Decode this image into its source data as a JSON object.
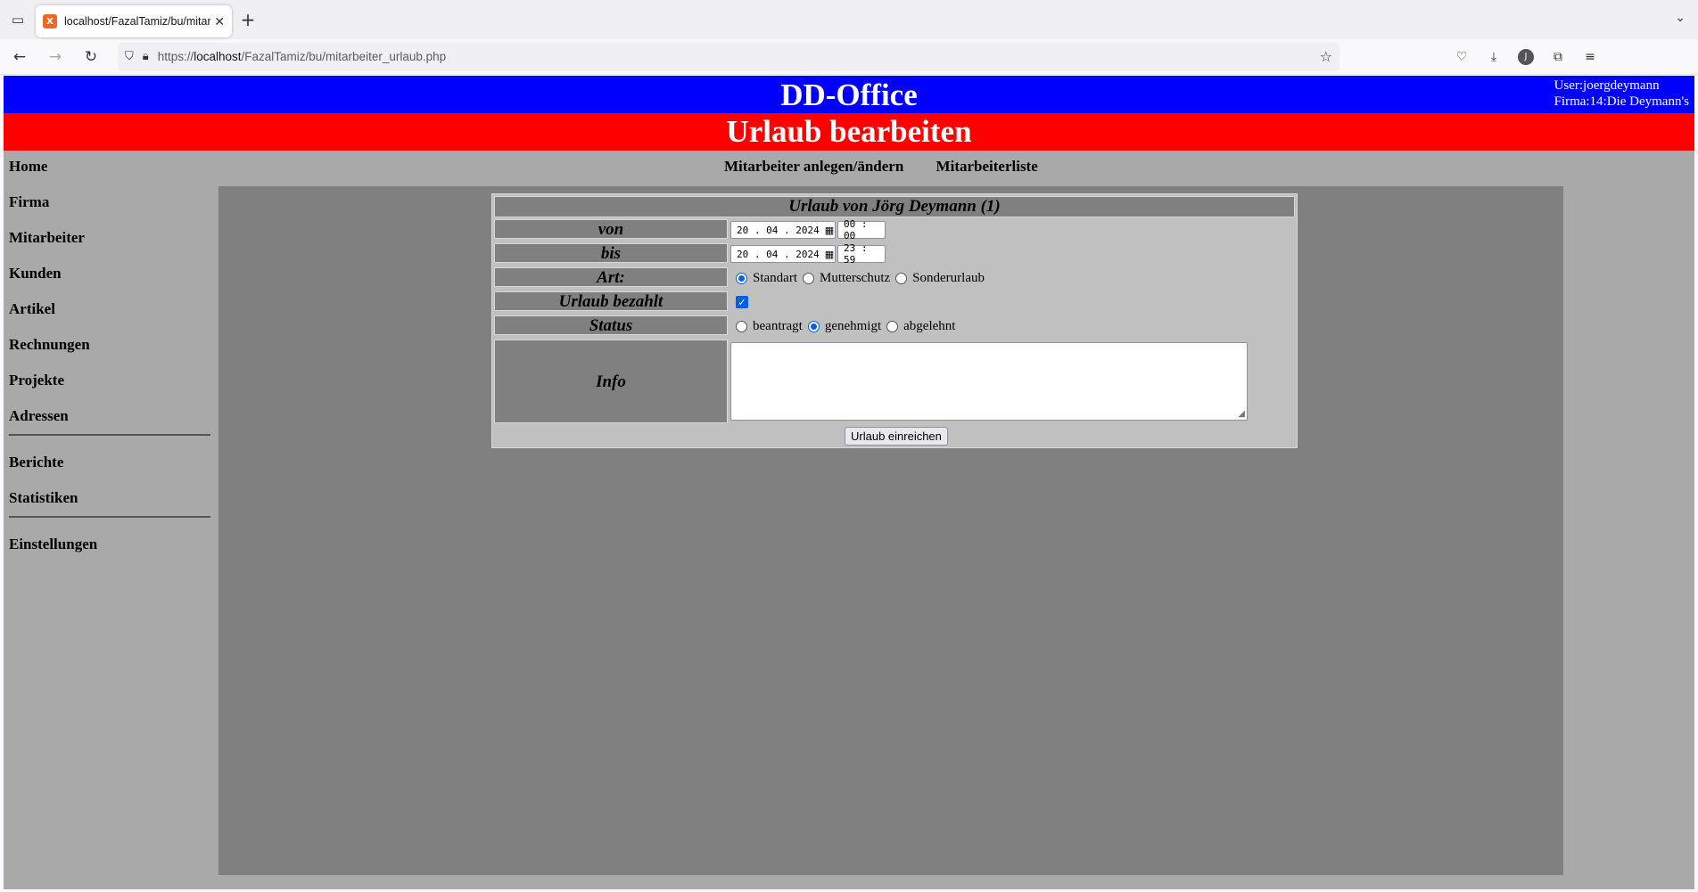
{
  "browser": {
    "tab_title": "localhost/FazalTamiz/bu/mitarb",
    "url_prefix": "https://",
    "url_host": "localhost",
    "url_path": "/FazalTamiz/bu/mitarbeiter_urlaub.php",
    "account_initial": "J"
  },
  "header": {
    "app_title": "DD-Office",
    "user_line": "User:joergdeymann",
    "company_line": "Firma:14:Die Deymann's",
    "page_title": "Urlaub bearbeiten"
  },
  "sidebar": {
    "items": [
      "Home",
      "Firma",
      "Mitarbeiter",
      "Kunden",
      "Artikel",
      "Rechnungen",
      "Projekte",
      "Adressen"
    ],
    "items2": [
      "Berichte",
      "Statistiken"
    ],
    "items3": [
      "Einstellungen"
    ]
  },
  "topnav": {
    "link1": "Mitarbeiter anlegen/ändern",
    "link2": "Mitarbeiterliste"
  },
  "form": {
    "title": "Urlaub von Jörg Deymann (1)",
    "von_label": "von",
    "von_date": "20 . 04 . 2024",
    "von_time": "00 : 00",
    "bis_label": "bis",
    "bis_date": "20 . 04 . 2024",
    "bis_time": "23 : 59",
    "art_label": "Art:",
    "art_options": [
      "Standart",
      "Mutterschutz",
      "Sonderurlaub"
    ],
    "art_selected": "Standart",
    "bezahlt_label": "Urlaub bezahlt",
    "bezahlt_checked": true,
    "status_label": "Status",
    "status_options": [
      "beantragt",
      "genehmigt",
      "abgelehnt"
    ],
    "status_selected": "genehmigt",
    "info_label": "Info",
    "info_value": "",
    "submit_label": "Urlaub einreichen"
  },
  "colors": {
    "header_blue": "#0000ff",
    "header_red": "#ff0000",
    "page_bg": "#a9a9a9",
    "content_bg": "#808080",
    "form_bg": "#c0c0c0"
  }
}
